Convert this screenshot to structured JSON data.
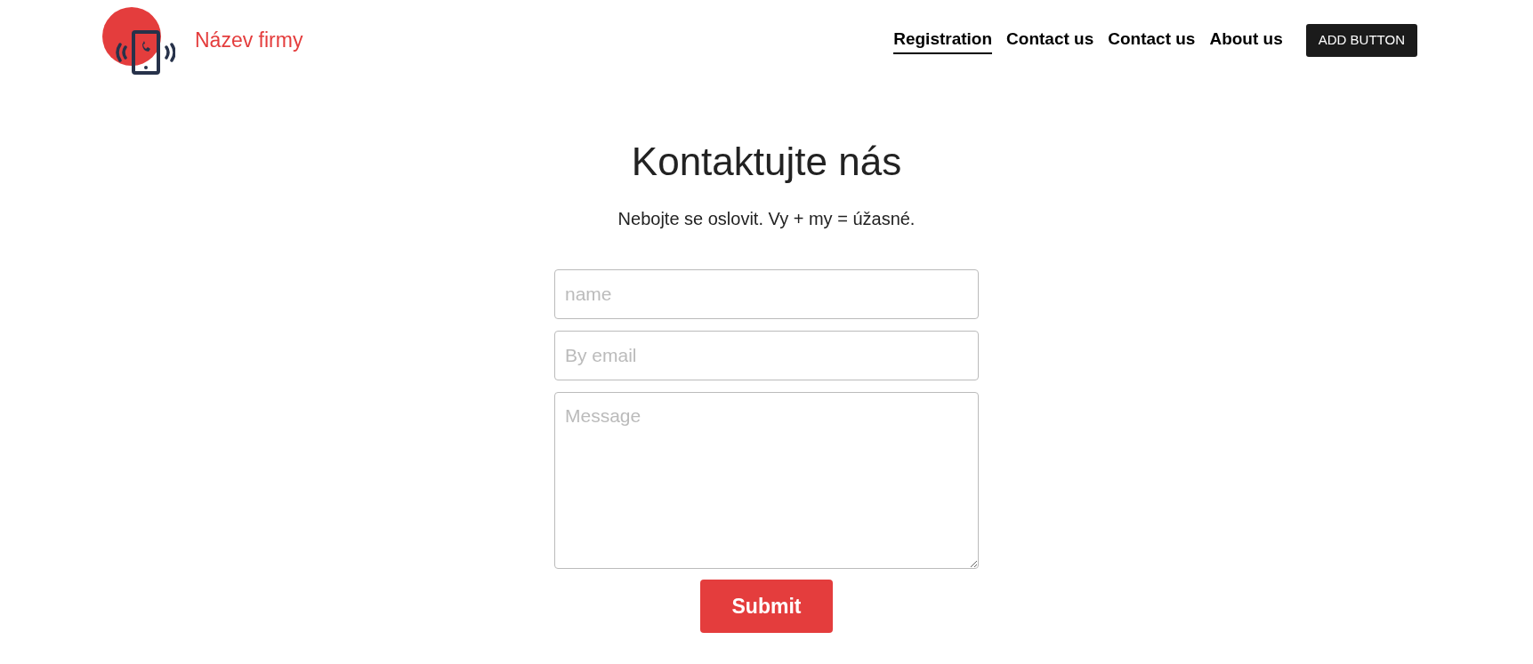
{
  "brand": {
    "name": "Název firmy"
  },
  "nav": [
    {
      "label": "Registration",
      "selected": true
    },
    {
      "label": "Contact us",
      "selected": false
    },
    {
      "label": "Contact us",
      "selected": false
    },
    {
      "label": "About us",
      "selected": false
    }
  ],
  "nav_button": "ADD BUTTON",
  "heading": "Kontaktujte nás",
  "subtitle": "Nebojte se oslovit. Vy + my = úžasné.",
  "form": {
    "fields": [
      {
        "kind": "input",
        "placeholder": "name"
      },
      {
        "kind": "input",
        "placeholder": "By email"
      },
      {
        "kind": "textarea",
        "placeholder": "Message"
      }
    ],
    "submit": "Submit"
  }
}
